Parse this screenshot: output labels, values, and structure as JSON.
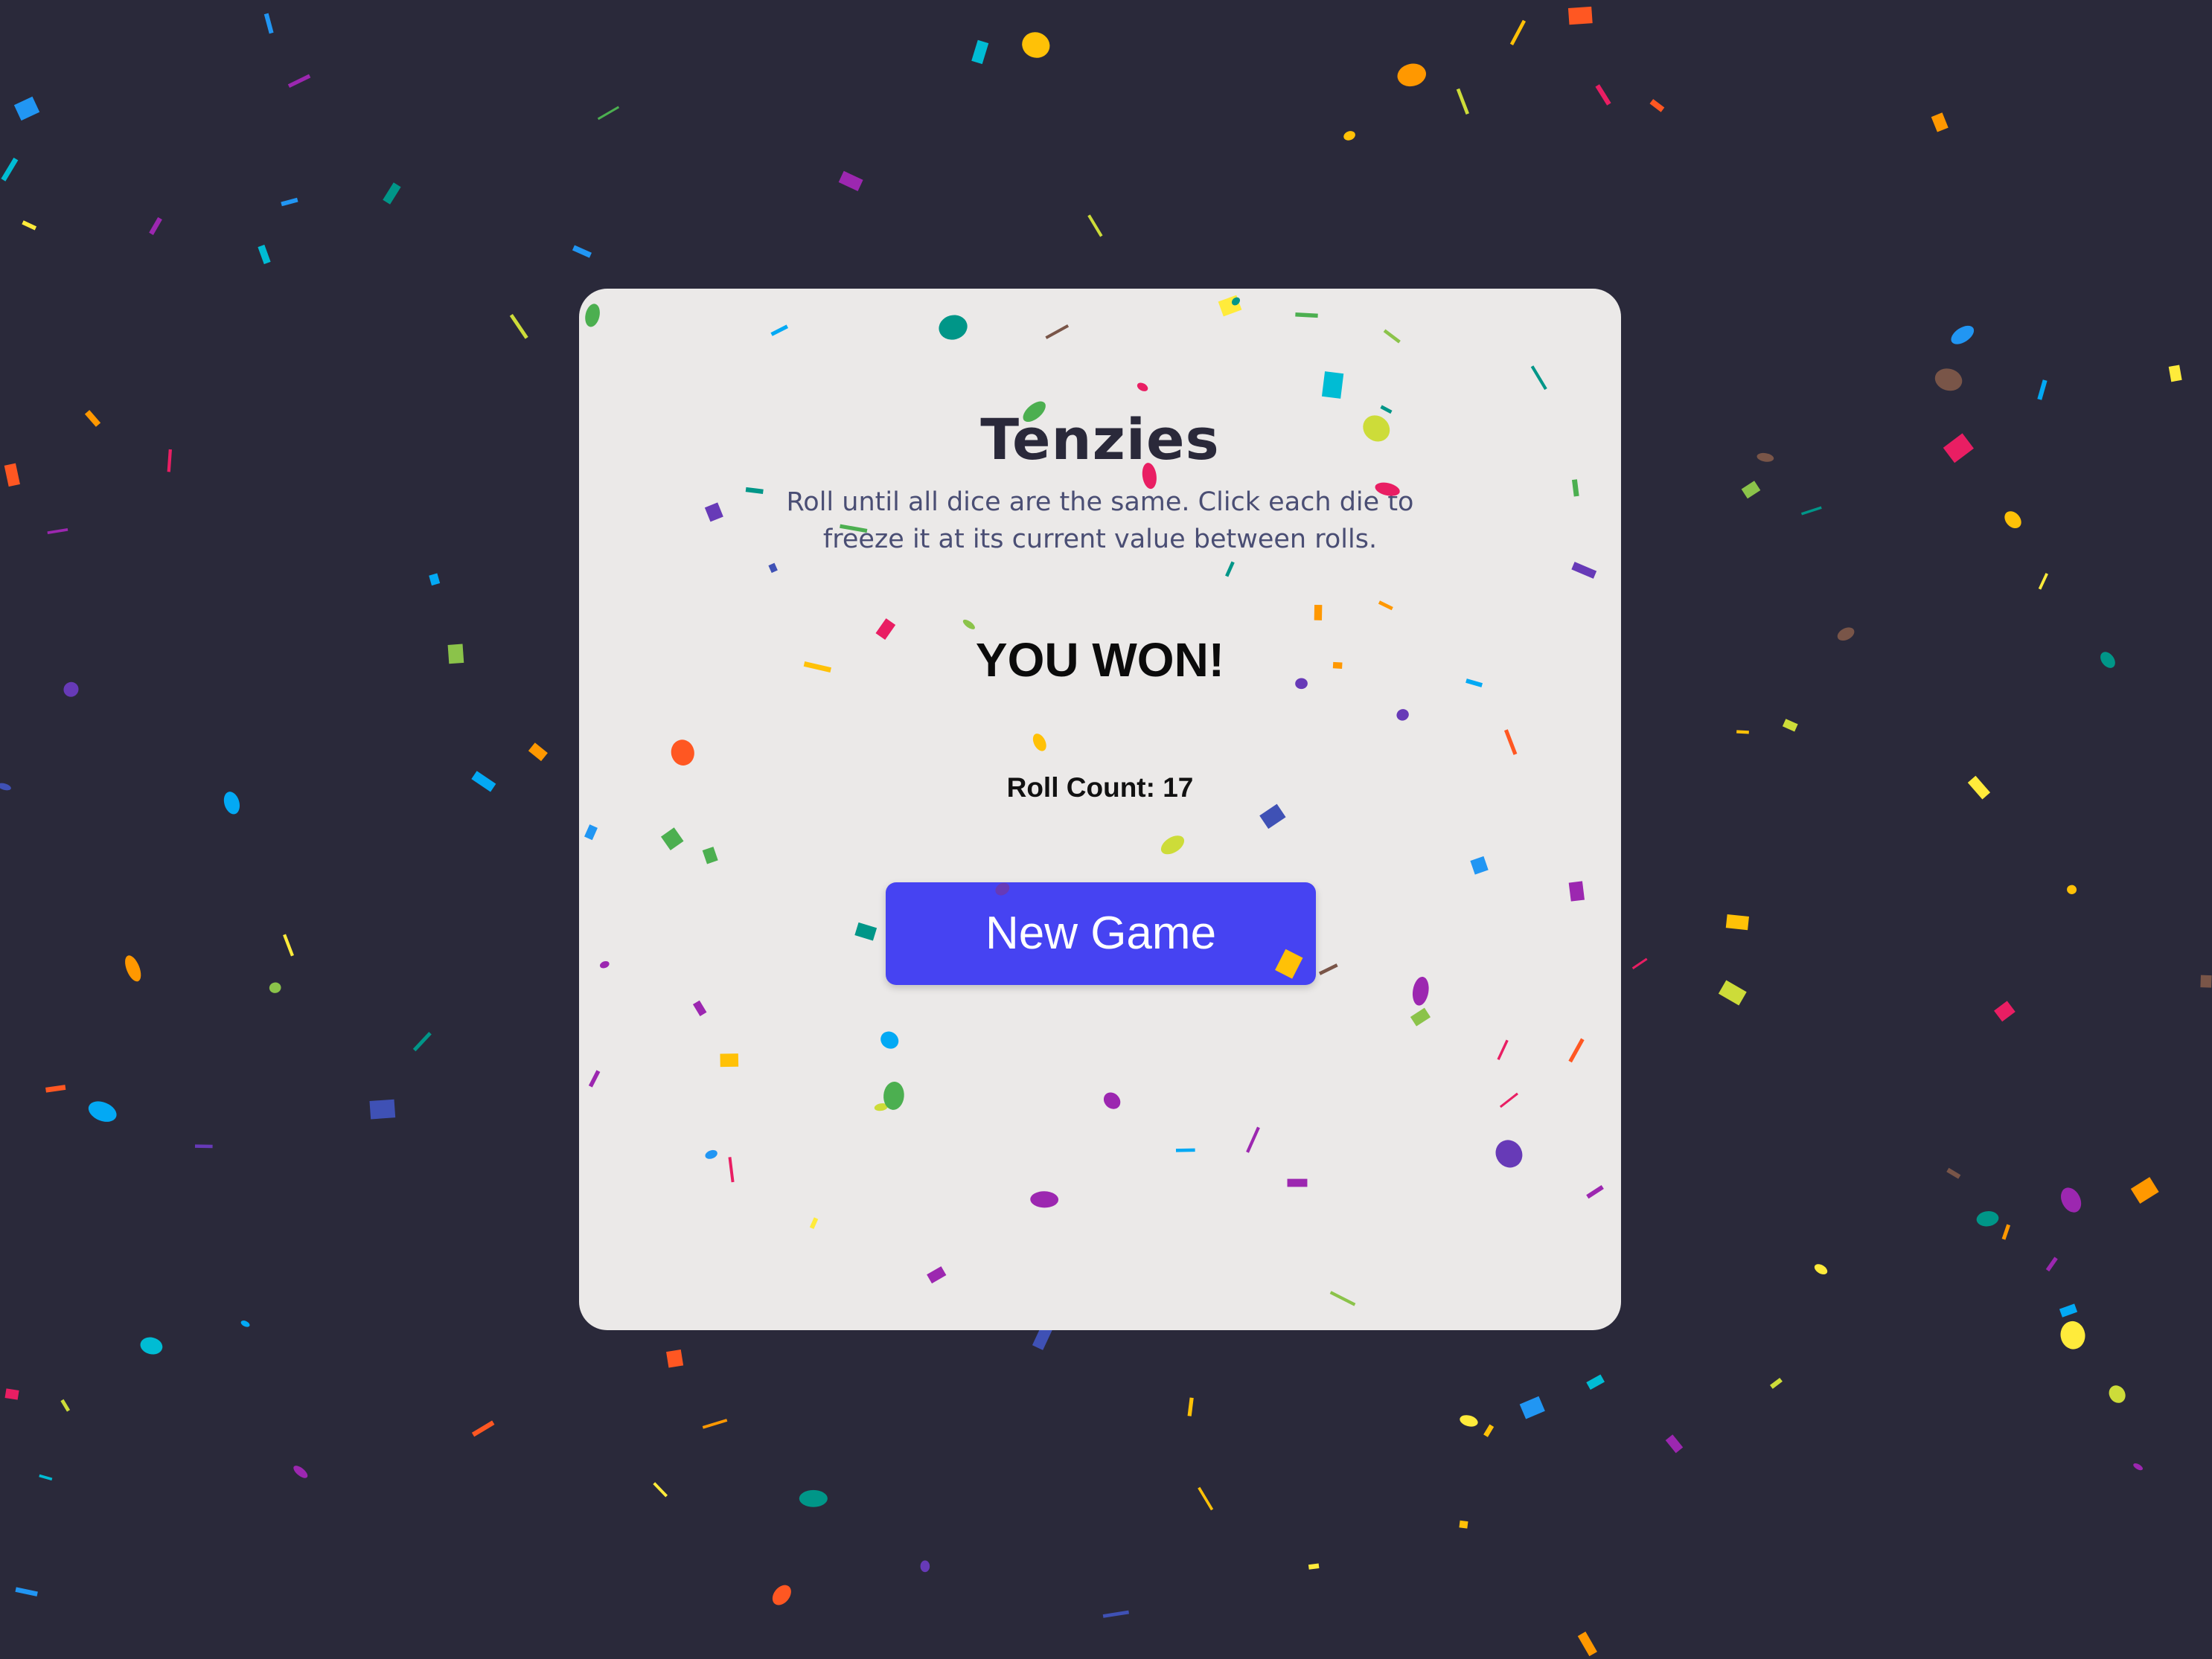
{
  "game": {
    "title": "Tenzies",
    "instructions": "Roll until all dice are the same. Click each die to freeze it at its current value between rolls.",
    "status": "YOU WON!",
    "roll_count_label": "Roll Count:",
    "roll_count": 17,
    "new_game_label": "New Game"
  },
  "colors": {
    "background": "#2a293a",
    "card": "#ebe9e8",
    "button": "#4643f2",
    "title": "#2a293a",
    "instructions": "#4a4e74"
  },
  "confetti_palette": [
    "#e91e63",
    "#2196f3",
    "#4caf50",
    "#ffeb3b",
    "#ff5722",
    "#9c27b0",
    "#673ab7",
    "#3f51b5",
    "#009688",
    "#ffc107",
    "#cddc39",
    "#8bc34a",
    "#ff9800",
    "#795548",
    "#03a9f4",
    "#00bcd4"
  ]
}
